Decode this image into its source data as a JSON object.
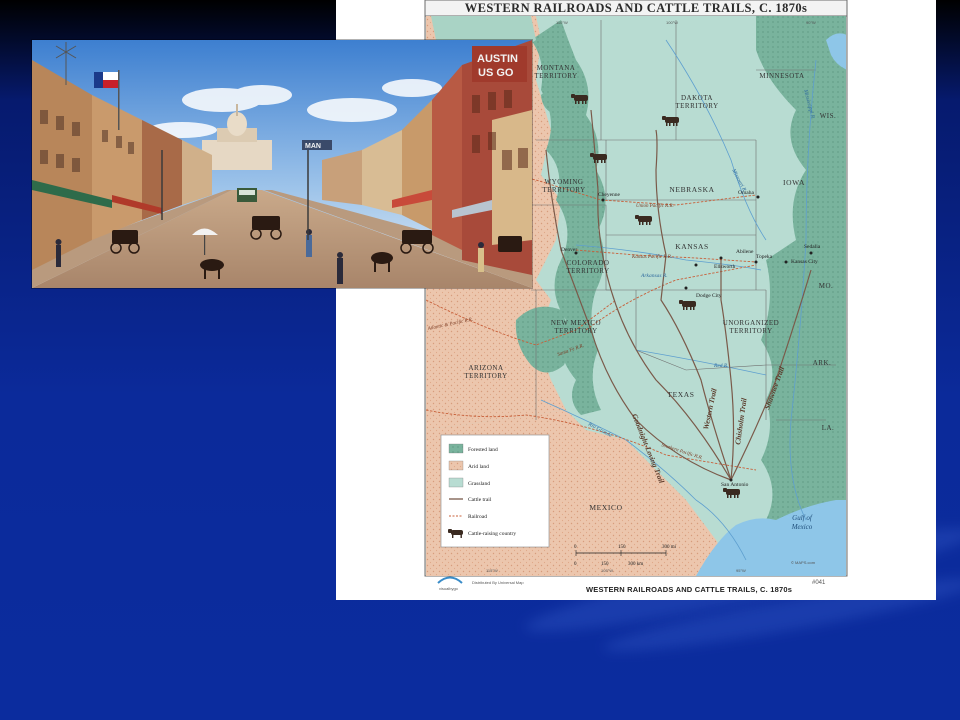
{
  "map": {
    "title": "WESTERN RAILROADS AND CATTLE TRAILS, C. 1870s",
    "footer_title": "WESTERN RAILROADS AND CATTLE TRAILS, C. 1870s",
    "map_number": "#041",
    "publisher": "visualbygo",
    "distributor": "Distributed By Universal Map",
    "regions": [
      {
        "id": "montana",
        "lines": [
          "MONTANA",
          "TERRITORY"
        ]
      },
      {
        "id": "dakota",
        "lines": [
          "DAKOTA",
          "TERRITORY"
        ]
      },
      {
        "id": "minnesota",
        "lines": [
          "MINNESOTA"
        ]
      },
      {
        "id": "wis",
        "lines": [
          "WIS."
        ]
      },
      {
        "id": "wyoming",
        "lines": [
          "WYOMING",
          "TERRITORY"
        ]
      },
      {
        "id": "nebraska",
        "lines": [
          "NEBRASKA"
        ]
      },
      {
        "id": "iowa",
        "lines": [
          "IOWA"
        ]
      },
      {
        "id": "colorado",
        "lines": [
          "COLORADO",
          "TERRITORY"
        ]
      },
      {
        "id": "kansas",
        "lines": [
          "KANSAS"
        ]
      },
      {
        "id": "mo",
        "lines": [
          "MO."
        ]
      },
      {
        "id": "new-mexico",
        "lines": [
          "NEW MEXICO",
          "TERRITORY"
        ]
      },
      {
        "id": "unorganized",
        "lines": [
          "UNORGANIZED",
          "TERRITORY"
        ]
      },
      {
        "id": "arizona",
        "lines": [
          "ARIZONA",
          "TERRITORY"
        ]
      },
      {
        "id": "ark",
        "lines": [
          "ARK."
        ]
      },
      {
        "id": "texas",
        "lines": [
          "TEXAS"
        ]
      },
      {
        "id": "la",
        "lines": [
          "LA."
        ]
      },
      {
        "id": "mexico",
        "lines": [
          "MEXICO"
        ]
      }
    ],
    "gulf": [
      "Gulf of",
      "Mexico"
    ],
    "cities": [
      "Cheyenne",
      "Omaha",
      "Denver",
      "Abilene",
      "Topeka",
      "Kansas City",
      "Sedalia",
      "Ellsworth",
      "Dodge City",
      "San Antonio"
    ],
    "trails": [
      "Goodnight-Loving Trail",
      "Western Trail",
      "Chisholm Trail",
      "Shawnee Trail"
    ],
    "railroads": [
      "Union Pacific R.R.",
      "Kansas Pacific R.R.",
      "Atlantic & Pacific R.R.",
      "Southern Pacific R.R.",
      "Santa Fe R.R."
    ],
    "rivers": [
      "Missouri R.",
      "Arkansas R.",
      "Red R.",
      "Rio Grande",
      "Mississippi R."
    ],
    "legend": [
      {
        "label": "Forested land",
        "color": "#7fb8a3"
      },
      {
        "label": "Arid land",
        "color": "#e8c0a8"
      },
      {
        "label": "Grassland",
        "color": "#b8dcd2"
      },
      {
        "label": "Cattle trail",
        "color": "#7a5a4a"
      },
      {
        "label": "Railroad",
        "color": "#c8603a"
      },
      {
        "label": "Cattle-raising country",
        "color": "#3a2a20"
      }
    ],
    "scale": {
      "mi_ticks": [
        "0",
        "150",
        "300 mi"
      ],
      "km_ticks": [
        "0",
        "150",
        "300 km"
      ]
    },
    "longitudes": [
      "110°W",
      "100°W",
      "90°W",
      "115°W",
      "105°W",
      "95°W"
    ],
    "copyright": "© MAPS.com"
  },
  "painting": {
    "signs": {
      "austin": "AUSTIN",
      "usgo": "US GO",
      "mid": "MAN"
    }
  },
  "colors": {
    "forest": "#7fb8a3",
    "grass": "#b8dcd2",
    "arid": "#e8c0a8",
    "water": "#8ec6e8",
    "trail": "#7a5a4a",
    "rail": "#c8603a"
  }
}
